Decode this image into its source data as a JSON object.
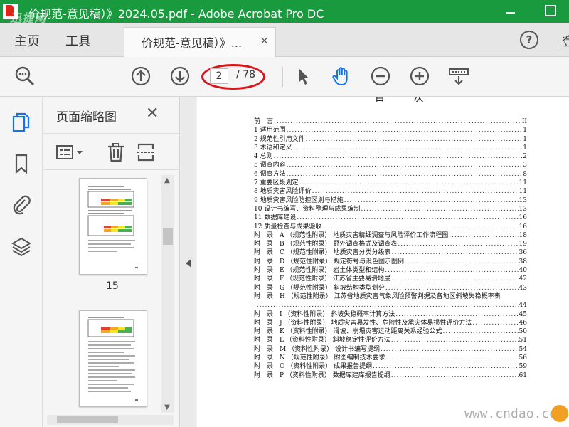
{
  "window": {
    "title": "价规范-意见稿）》2024.05.pdf - Adobe Acrobat Pro DC",
    "watermark_left": "迅捷网",
    "minimize_label": "—",
    "maximize_label": "□"
  },
  "tabs": {
    "home": "主页",
    "tools": "工具",
    "document_tab_label": "价规范-意见稿）》...",
    "document_tab_close": "×",
    "help_label": "?",
    "sign_in_partial": "登"
  },
  "toolbar": {
    "current_page": "2",
    "total_pages": "/ 78",
    "icons": [
      "zoom-search-icon",
      "page-up-icon",
      "page-down-icon",
      "select-cursor-icon",
      "hand-tool-icon",
      "zoom-out-icon",
      "zoom-in-icon",
      "scroll-mode-icon"
    ]
  },
  "rail": {
    "icons": [
      "page-thumbnails-icon",
      "bookmark-icon",
      "attachment-icon",
      "layers-icon"
    ]
  },
  "thumbnails_panel": {
    "title": "页面缩略图",
    "close_label": "✕",
    "tools": [
      "options-menu-icon",
      "delete-icon",
      "extract-icon"
    ],
    "pages": [
      {
        "label": "15"
      },
      {
        "label": ""
      }
    ]
  },
  "document": {
    "toc_title": "目 次",
    "toc": [
      {
        "text": "前　言",
        "page": "II"
      },
      {
        "text": "1 适用范围",
        "page": "1"
      },
      {
        "text": "2 规范性引用文件",
        "page": "1"
      },
      {
        "text": "3 术语和定义",
        "page": "1"
      },
      {
        "text": "4 总则",
        "page": "2"
      },
      {
        "text": "5 调查内容",
        "page": "3"
      },
      {
        "text": "6 调查方法",
        "page": "8"
      },
      {
        "text": "7 重要区段划定",
        "page": "11"
      },
      {
        "text": "8 地质灾害风险评价",
        "page": "11"
      },
      {
        "text": "9 地质灾害风险防控区划与措施",
        "page": "13"
      },
      {
        "text": "10 设计书编写、资料整理与成果编制",
        "page": "13"
      },
      {
        "text": "11 数据库建设",
        "page": "16"
      },
      {
        "text": "12 质量检查与成果验收",
        "page": "16"
      },
      {
        "text": "附　录　A （规范性附录）  地质灾害精细调查与风险评价工作流程图",
        "page": "18"
      },
      {
        "text": "附　录　B （规范性附录）  野外调查格式及调查表",
        "page": "19"
      },
      {
        "text": "附　录　C （规范性附录）  地质灾害分类分级表",
        "page": "36"
      },
      {
        "text": "附　录　D （规范性附录）  规定符号与设色图示图例",
        "page": "38"
      },
      {
        "text": "附　录　E （规范性附录）  岩土体类型和结构",
        "page": "40"
      },
      {
        "text": "附　录　F （规范性附录）  江苏省主要易滑地层",
        "page": "42"
      },
      {
        "text": "附　录　G （规范性附录）  斜坡结构类型划分",
        "page": "43"
      },
      {
        "text": "附　录　H （规范性附录）  江苏省地质灾害气象风险预警判据及各地区斜坡失稳概率表",
        "page": ""
      },
      {
        "text": "",
        "page": "44"
      },
      {
        "text": "附　录　I （资料性附录）  斜坡失稳概率计算方法",
        "page": "45"
      },
      {
        "text": "附　录　J （资料性附录）  地质灾害易发性、危险性及承灾体易损性评价方法",
        "page": "46"
      },
      {
        "text": "附　录　K （资料性附录）  滑坡、崩塌灾害运动距离关系经验公式",
        "page": "50"
      },
      {
        "text": "附　录　L （资料性附录）  斜坡稳定性评价方法",
        "page": "51"
      },
      {
        "text": "附　录　M （资料性附录）  设计书编写提纲",
        "page": "54"
      },
      {
        "text": "附　录　N （规范性附录）  附图编制技术要求",
        "page": "56"
      },
      {
        "text": "附　录　O （资料性附录）  成果报告提纲",
        "page": "59"
      },
      {
        "text": "附　录　P （资料性附录）  数据库建库报告提纲",
        "page": "61"
      }
    ]
  },
  "watermark_bottom": "www.cndao.com",
  "colors": {
    "title_bar": "#1a9a3f",
    "accent_blue": "#1473e6",
    "annotation_red": "#d8151a"
  }
}
